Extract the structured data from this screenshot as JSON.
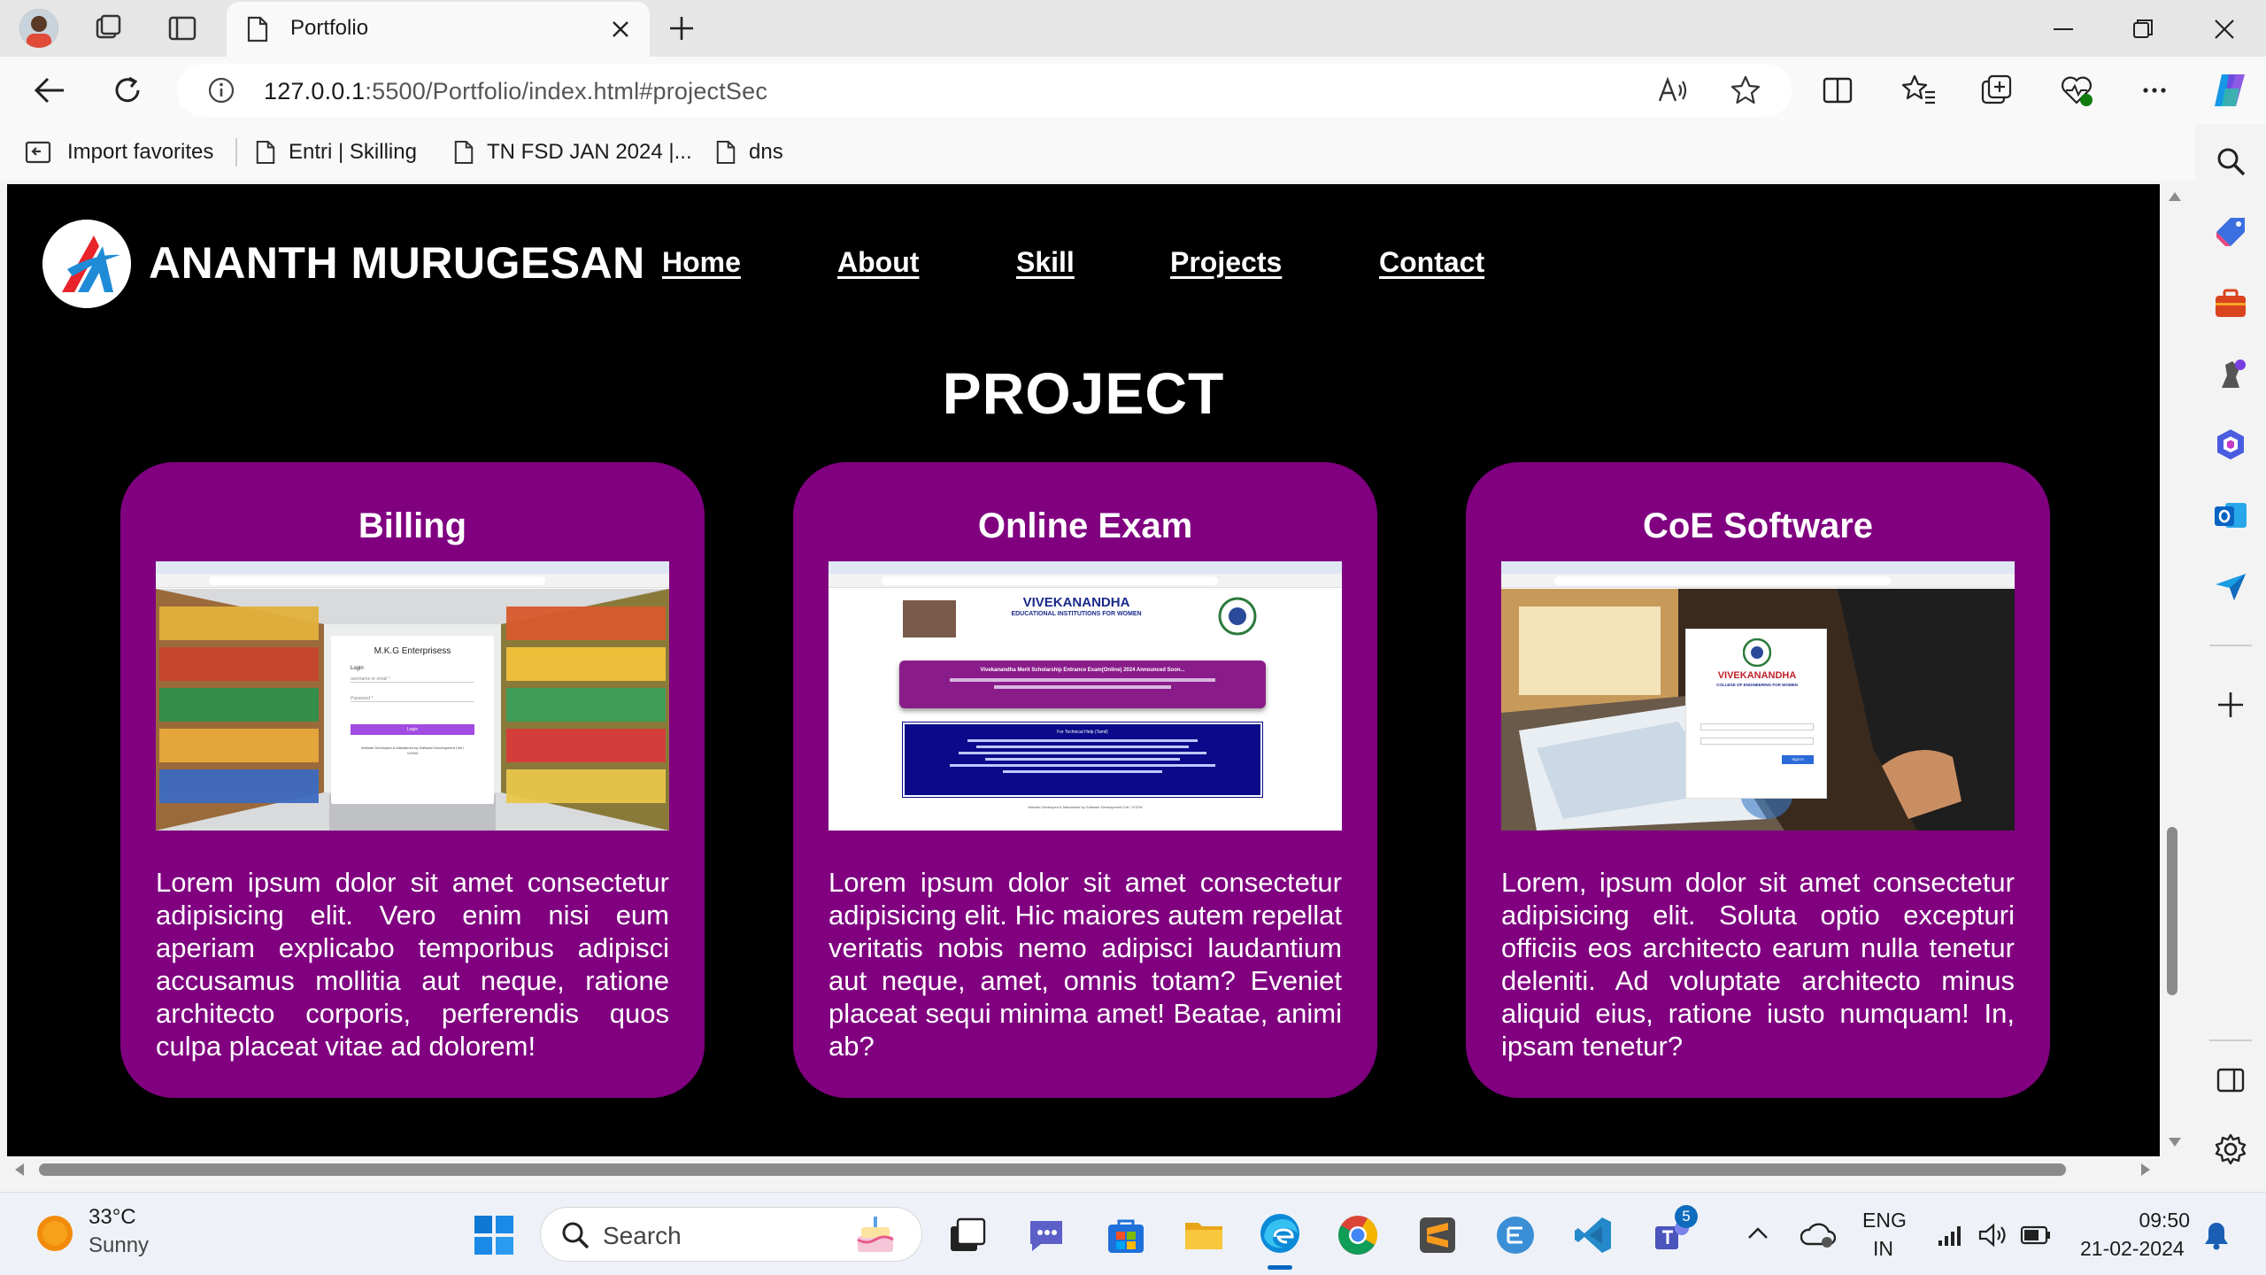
{
  "browser": {
    "tab_title": "Portfolio",
    "url_host": "127.0.0.1",
    "url_rest": ":5500/Portfolio/index.html#projectSec",
    "favorites": [
      "Import favorites",
      "Entri | Skilling",
      "TN FSD JAN 2024 |...",
      "dns"
    ]
  },
  "site": {
    "brand": "ANANTH MURUGESAN",
    "nav": [
      "Home",
      "About",
      "Skill",
      "Projects",
      "Contact"
    ],
    "section_title": "PROJECT",
    "cards": [
      {
        "title": "Billing",
        "description": "Lorem ipsum dolor sit amet consectetur adipisicing elit. Vero enim nisi eum aperiam explicabo temporibus adipisci accusamus mollitia aut neque, ratione architecto corporis, perferendis quos culpa placeat vitae ad dolorem!",
        "shot": {
          "company": "M.K.G Enterprisess",
          "login": "Login",
          "username_placeholder": "username or email *",
          "password_placeholder": "Password *",
          "button": "Login",
          "footer": "Website Developed & Maintained by Software Development Cell / VCEW"
        }
      },
      {
        "title": "Online Exam",
        "description": "Lorem ipsum dolor sit amet consectetur adipisicing elit. Hic maiores autem repellat veritatis nobis nemo adipisci laudantium aut neque, amet, omnis totam? Eveniet placeat sequi minima amet! Beatae, animi ab?",
        "shot": {
          "org": "VIVEKANANDHA",
          "org_sub": "EDUCATIONAL INSTITUTIONS FOR WOMEN",
          "banner": "Vivekanandha Merit Scholarship Entrance Exam(Online) 2024 Announced Soon...",
          "help_title": "For Technical Help (Tamil)",
          "footer": "Website Developed & Maintained by Software Development Cell / VCEW"
        }
      },
      {
        "title": "CoE Software",
        "description": "Lorem, ipsum dolor sit amet consectetur adipisicing elit. Soluta optio excepturi officiis eos architecto earum nulla tenetur deleniti. Ad voluptate architecto minus aliquid eius, ratione iusto numquam! In, ipsam tenetur?",
        "shot": {
          "org": "VIVEKANANDHA",
          "org_sub": "COLLEGE OF ENGINEERING FOR WOMEN",
          "button": "Sign in"
        }
      }
    ]
  },
  "taskbar": {
    "temperature": "33°C",
    "weather": "Sunny",
    "search_label": "Search",
    "badge_count": "5",
    "lang_primary": "ENG",
    "lang_secondary": "IN",
    "time": "09:50",
    "date": "21-02-2024"
  },
  "colors": {
    "card_bg": "#800080",
    "page_bg": "#000000",
    "accent": "#0078d4"
  }
}
